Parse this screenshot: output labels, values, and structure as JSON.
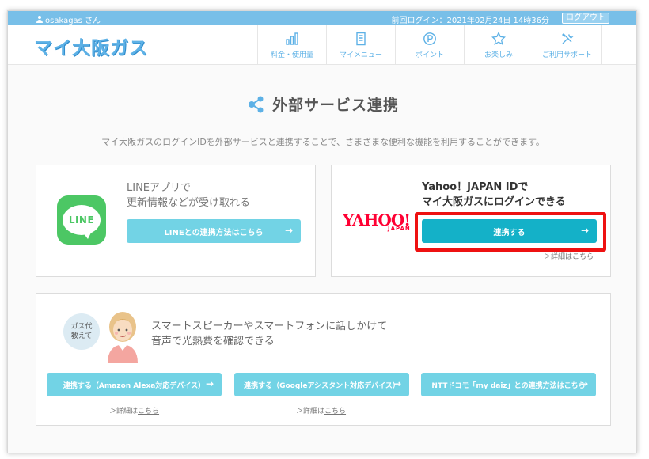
{
  "userbar": {
    "username": "osakagas さん",
    "last_login": "前回ログイン：2021年02月24日 14時36分",
    "logout_label": "ログアウト"
  },
  "header": {
    "logo_text": "マイ大阪ガス",
    "nav": [
      {
        "label": "料金・使用量",
        "icon": "bar-chart-icon"
      },
      {
        "label": "マイメニュー",
        "icon": "document-icon"
      },
      {
        "label": "ポイント",
        "icon": "point-icon"
      },
      {
        "label": "お楽しみ",
        "icon": "star-icon"
      },
      {
        "label": "ご利用サポート",
        "icon": "tools-icon"
      }
    ]
  },
  "page": {
    "title": "外部サービス連携",
    "intro": "マイ大阪ガスのログインIDを外部サービスと連携することで、さまざまな便利な機能を利用することができます。"
  },
  "line_card": {
    "icon_text": "LINE",
    "heading_1": "LINEアプリで",
    "heading_2": "更新情報などが受け取れる",
    "button_label": "LINEとの連携方法はこちら"
  },
  "yahoo_card": {
    "logo_text": "YAHOO!",
    "logo_sub": "JAPAN",
    "heading_1": "Yahoo！JAPAN IDで",
    "heading_2": "マイ大阪ガスにログインできる",
    "button_label": "連携する",
    "detail_prefix": "＞詳細は",
    "detail_link": "こちら"
  },
  "voice_card": {
    "bubble_line_1": "ガス代",
    "bubble_line_2": "教えて",
    "heading_1": "スマートスピーカーやスマートフォンに話しかけて",
    "heading_2": "音声で光熱費を確認できる",
    "buttons": [
      {
        "label": "連携する（Amazon Alexa対応デバイス）"
      },
      {
        "label": "連携する（Googleアシスタント対応デバイス）"
      },
      {
        "label": "NTTドコモ「my daiz」との連携方法はこちら"
      }
    ],
    "detail_prefix": "＞詳細は",
    "detail_link": "こちら"
  },
  "colors": {
    "accent": "#5db1e6",
    "button_light": "#72d3e5",
    "button_dark": "#14b1c8",
    "line_green": "#4cc764",
    "yahoo_red": "#ff0033",
    "highlight_red": "#ee1111"
  }
}
